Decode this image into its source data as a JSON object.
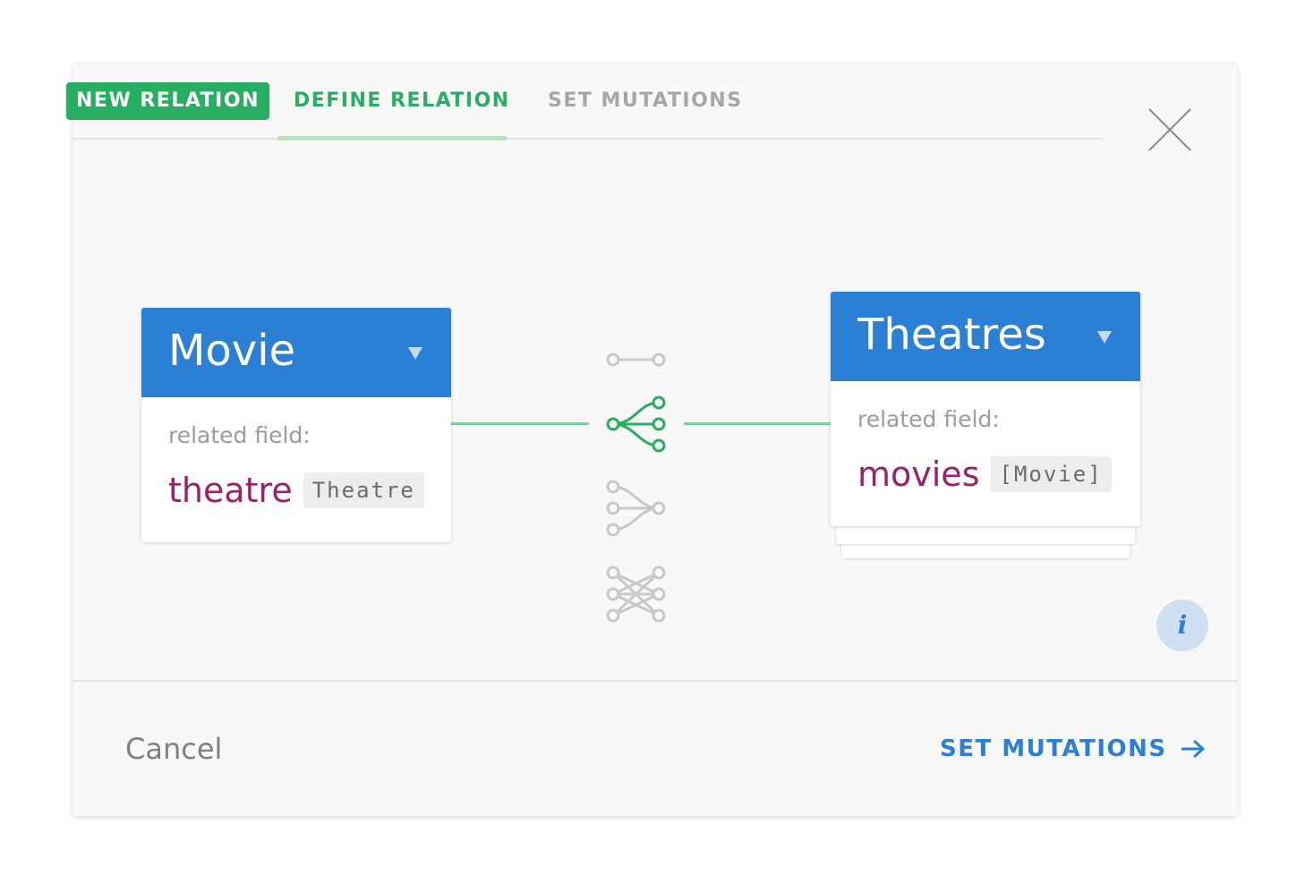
{
  "header": {
    "badge": "NEW RELATION",
    "tabs": [
      {
        "label": "DEFINE RELATION",
        "active": true
      },
      {
        "label": "SET MUTATIONS",
        "active": false
      }
    ]
  },
  "left_model": {
    "name": "Movie",
    "related_field_label": "related field:",
    "field_name": "theatre",
    "field_type": "Theatre"
  },
  "right_model": {
    "name": "Theatres",
    "related_field_label": "related field:",
    "field_name": "movies",
    "field_type": "[Movie]"
  },
  "relation_types": [
    {
      "icon": "one-to-one-icon",
      "selected": false
    },
    {
      "icon": "one-to-many-icon",
      "selected": true
    },
    {
      "icon": "many-to-one-icon",
      "selected": false
    },
    {
      "icon": "many-to-many-icon",
      "selected": false
    }
  ],
  "footer": {
    "cancel_label": "Cancel",
    "next_label": "SET MUTATIONS"
  },
  "colors": {
    "accent_green": "#27ae60",
    "model_blue": "#2b7fd4",
    "field_purple": "#99226d",
    "inactive_gray": "#c8c8c8"
  }
}
